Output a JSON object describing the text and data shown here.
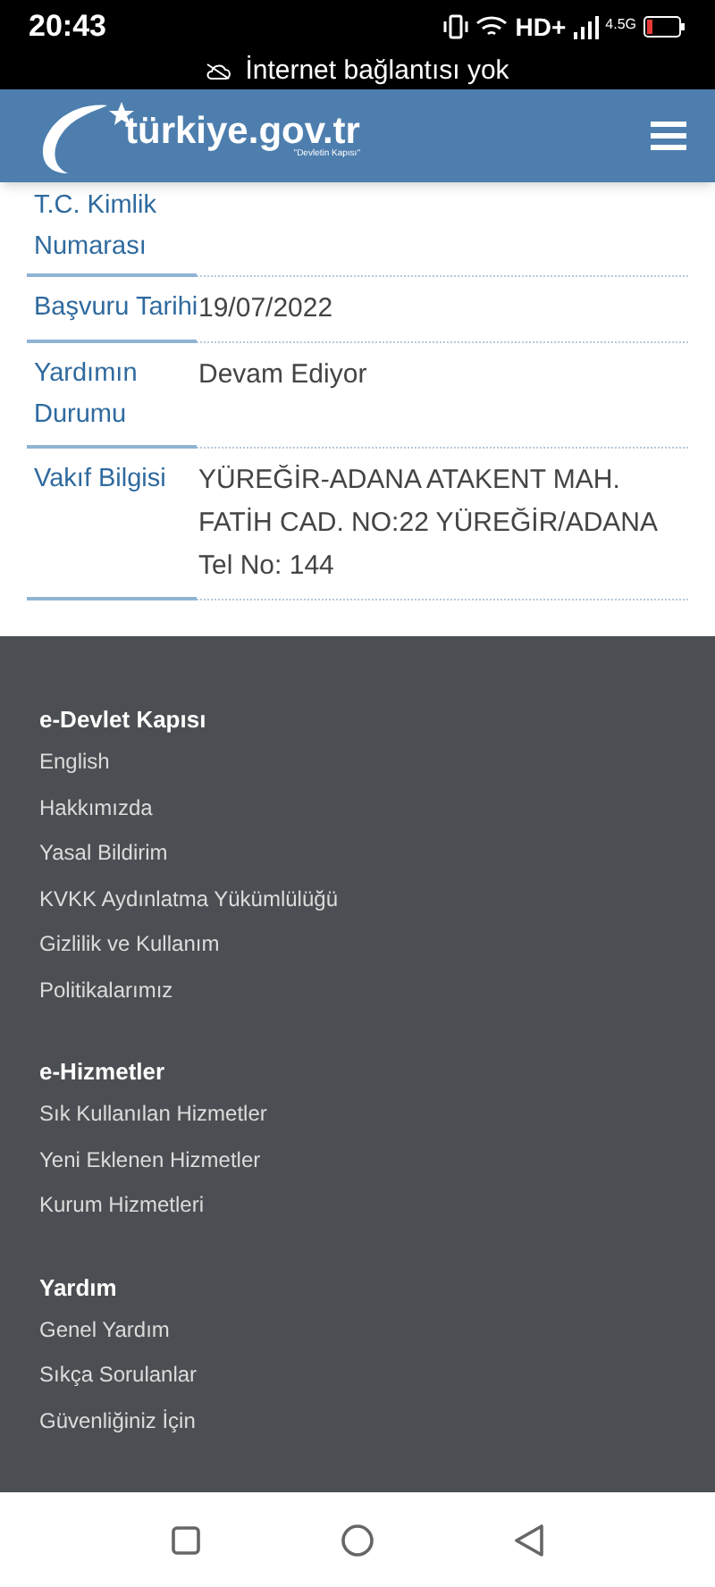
{
  "status_bar": {
    "time": "20:43",
    "network": "HD+",
    "network_type": "4.5G"
  },
  "notice": {
    "text": "İnternet bağlantısı yok"
  },
  "header": {
    "logo_text": "türkiye.gov.tr",
    "logo_tagline": "\"Devletin Kapısı\""
  },
  "details": [
    {
      "label": "T.C. Kimlik Numarası"
    },
    {
      "label": "Başvuru Tarihi",
      "value": "19/07/2022"
    },
    {
      "label": "Yardımın Durumu",
      "value": "Devam Ediyor"
    },
    {
      "label": "Vakıf Bilgisi",
      "value": "YÜREĞİR-ADANA ATAKENT MAH. FATİH CAD. NO:22 YÜREĞİR/ADANA Tel No: 144"
    }
  ],
  "footer": [
    {
      "heading": "e-Devlet Kapısı",
      "links": [
        "English",
        "Hakkımızda",
        "Yasal Bildirim",
        "KVKK Aydınlatma Yükümlülüğü",
        "Gizlilik ve Kullanım",
        "Politikalarımız"
      ]
    },
    {
      "heading": "e-Hizmetler",
      "links": [
        "Sık Kullanılan Hizmetler",
        "Yeni Eklenen Hizmetler",
        "Kurum Hizmetleri"
      ]
    },
    {
      "heading": "Yardım",
      "links": [
        "Genel Yardım",
        "Sıkça Sorulanlar",
        "Güvenliğiniz İçin"
      ]
    }
  ]
}
